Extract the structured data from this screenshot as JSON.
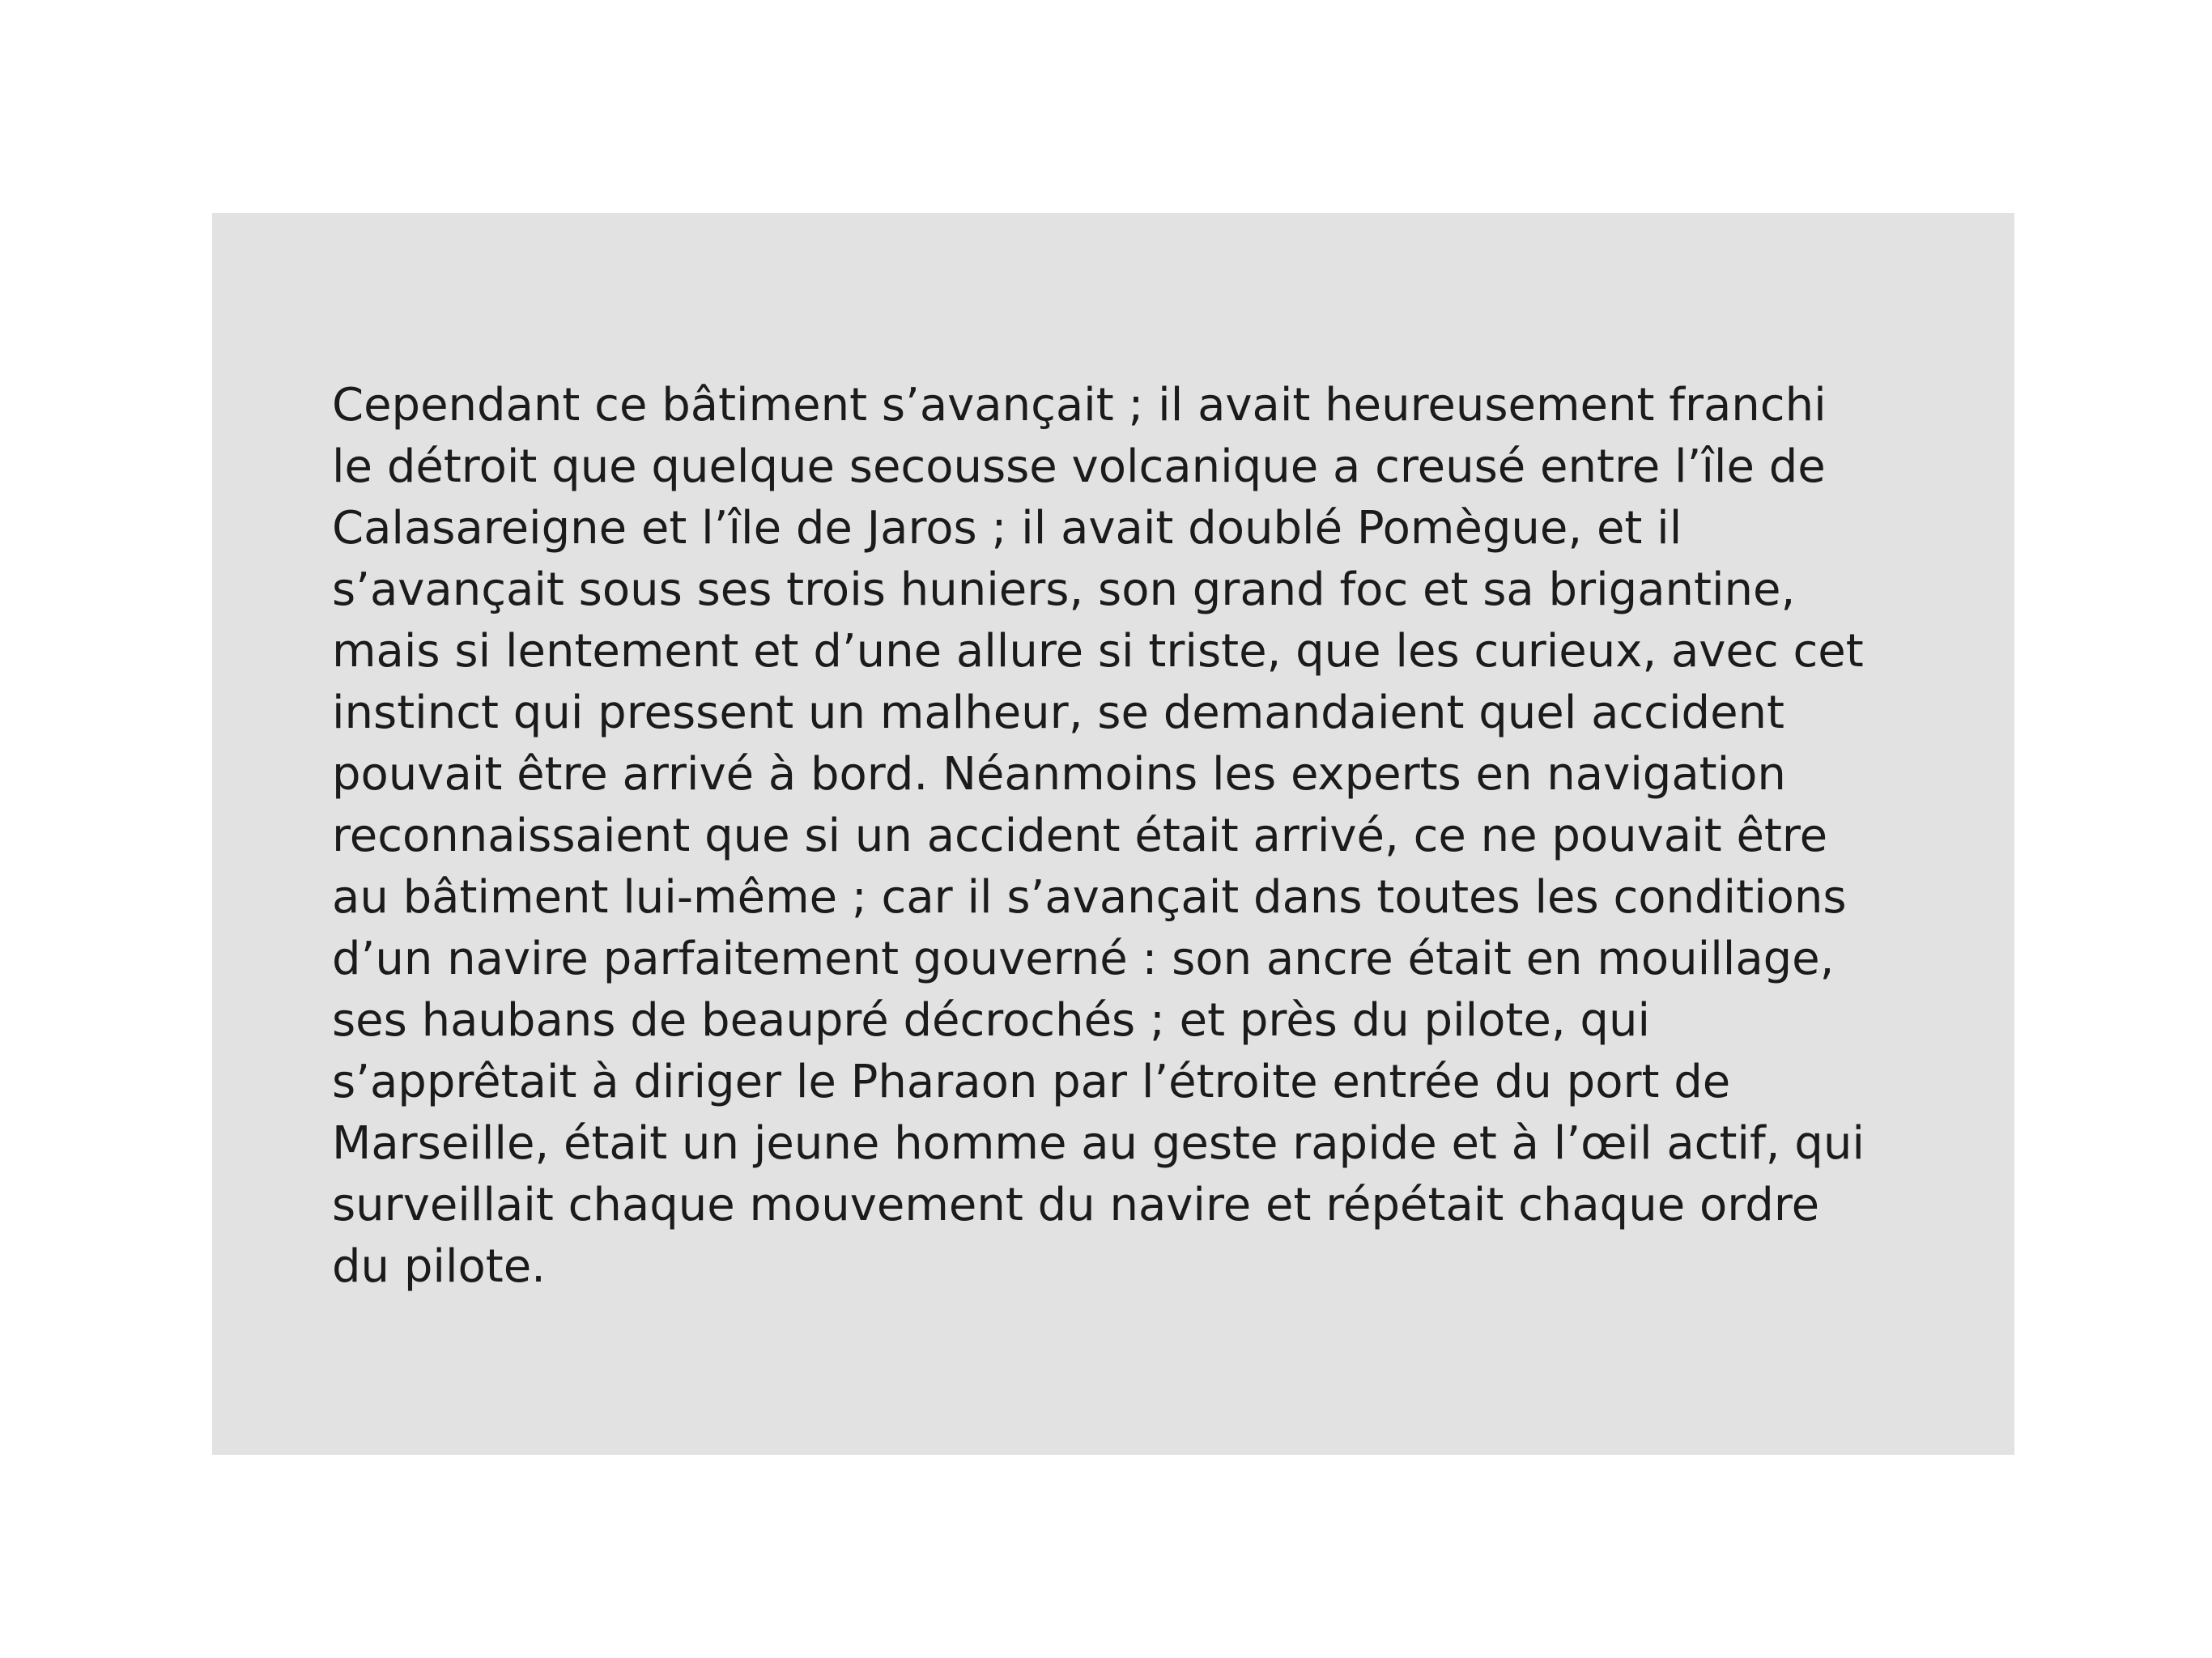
{
  "passage": {
    "lines": [
      "Cependant ce bâtiment s’avançait ; il avait heureusement franchi",
      "le détroit que quelque secousse volcanique a creusé entre l’île de",
      "Calasareigne et l’île de Jaros ; il avait doublé Pomègue, et il",
      "s’avançait sous ses trois huniers, son grand foc et sa brigantine,",
      "mais si lentement et d’une allure si triste, que les curieux, avec cet",
      "instinct qui pressent un malheur, se demandaient quel accident",
      "pouvait être arrivé à bord. Néanmoins les experts en navigation",
      "reconnaissaient que si un accident était arrivé, ce ne pouvait être",
      "au bâtiment lui-même ; car il s’avançait dans toutes les conditions",
      "d’un navire parfaitement gouverné : son ancre était en mouillage,",
      "ses haubans de beaupré décrochés ; et près du pilote, qui",
      "s’apprêtait à diriger le Pharaon par l’étroite entrée du port de",
      "Marseille, était un jeune homme au geste rapide et à l’œil actif, qui",
      "surveillait chaque mouvement du navire et répétait chaque ordre",
      "du pilote."
    ]
  },
  "colors": {
    "page_background": "#ffffff",
    "panel_background": "#e2e2e2",
    "text": "#1b1b1b"
  }
}
